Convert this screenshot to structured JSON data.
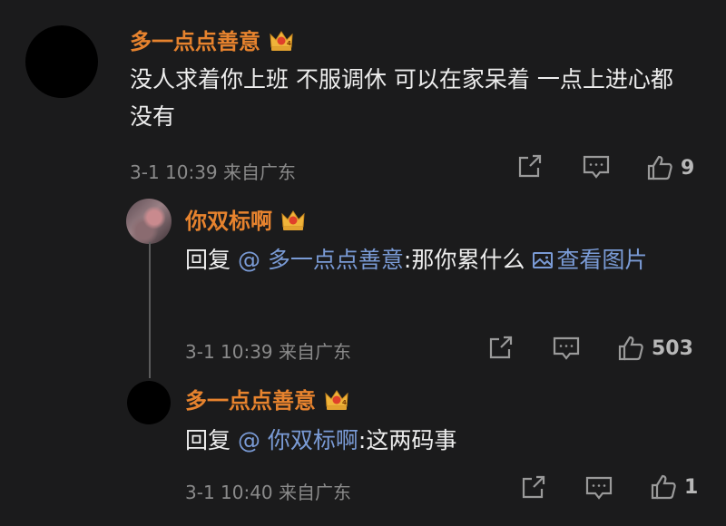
{
  "comments": [
    {
      "author": "多一点点善意",
      "text": "没人求着你上班  不服调休 可以在家呆着  一点上进心都没有",
      "time": "3-1 10:39",
      "location": "来自广东",
      "likes": "9"
    },
    {
      "author": "你双标啊",
      "reply_prefix": "回复",
      "mention": "@ 多一点点善意",
      "text": ":那你累什么",
      "image_link": "查看图片",
      "time": "3-1 10:39",
      "location": "来自广东",
      "likes": "503"
    },
    {
      "author": "多一点点善意",
      "reply_prefix": "回复",
      "mention": "@ 你双标啊",
      "text": ":这两码事",
      "time": "3-1 10:40",
      "location": "来自广东",
      "likes": "1"
    }
  ],
  "colors": {
    "background": "#1b1b1c",
    "username": "#e7832e",
    "mention": "#7a9bd6",
    "meta": "#8a8a8a"
  },
  "icons": [
    "crown-badge-icon",
    "share-icon",
    "comment-icon",
    "thumbs-up-icon",
    "image-icon"
  ]
}
